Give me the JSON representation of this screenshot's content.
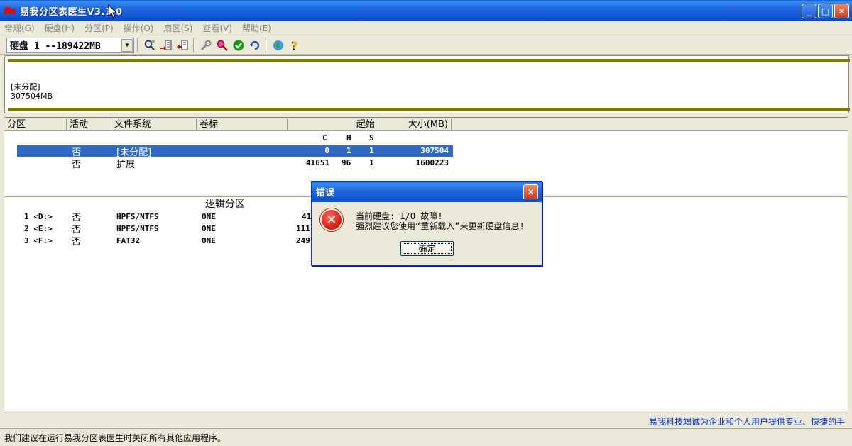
{
  "window": {
    "title": "易我分区表医生V3.1.0"
  },
  "menu": [
    {
      "label": "常规(G)"
    },
    {
      "label": "硬盘(H)"
    },
    {
      "label": "分区(P)"
    },
    {
      "label": "操作(O)"
    },
    {
      "label": "扇区(S)"
    },
    {
      "label": "查看(V)"
    },
    {
      "label": "帮助(E)"
    }
  ],
  "toolbar": {
    "disk_select": "硬盘 1 --189422MB",
    "icons": [
      "search-disk-icon",
      "write-mbr-icon",
      "restore-icon",
      "tools-icon",
      "find-icon",
      "check-icon",
      "refresh-icon",
      "web-icon",
      "help-icon"
    ]
  },
  "diskmap": {
    "label": "[未分配]",
    "size": "307504MB",
    "bar_color": "#7E7A00"
  },
  "partitions": {
    "headers": {
      "part": "分区",
      "active": "活动",
      "fs": "文件系统",
      "vol": "卷标",
      "start": "起始",
      "size": "大小(MB)"
    },
    "sub_headers": {
      "c": "C",
      "h": "H",
      "s": "S"
    },
    "rows": [
      {
        "part": "",
        "active": "否",
        "fs": "[未分配]",
        "vol": "",
        "c": "0",
        "h": "1",
        "s": "1",
        "size": "307504"
      },
      {
        "part": "",
        "active": "否",
        "fs": "扩展",
        "vol": "",
        "c": "41651",
        "h": "96",
        "s": "1",
        "size": "1600223"
      }
    ]
  },
  "logical": {
    "title": "逻辑分区",
    "rows": [
      {
        "part": "1 <D:>",
        "active": "否",
        "fs": "HPFS/NTFS",
        "vol": "ONE",
        "c": "41"
      },
      {
        "part": "2 <E:>",
        "active": "否",
        "fs": "HPFS/NTFS",
        "vol": "ONE",
        "c": "111"
      },
      {
        "part": "3 <F:>",
        "active": "否",
        "fs": "FAT32",
        "vol": "ONE",
        "c": "249"
      }
    ]
  },
  "info_bar": {
    "text": "易我科技竭诚为企业和个人用户提供专业、快捷的手"
  },
  "status_bar": {
    "text": "我们建议在运行易我分区表医生时关闭所有其他应用程序。"
  },
  "dialog": {
    "title": "错误",
    "line1": "当前硬盘: I/O 故障!",
    "line2": "强烈建议您使用“重新载入”来更新硬盘信息!",
    "ok": "确定"
  },
  "colors": {
    "title_blue": "#0B4FCB",
    "selection": "#316AC5",
    "link_blue": "#0033CC",
    "error_red": "#D01A08"
  }
}
